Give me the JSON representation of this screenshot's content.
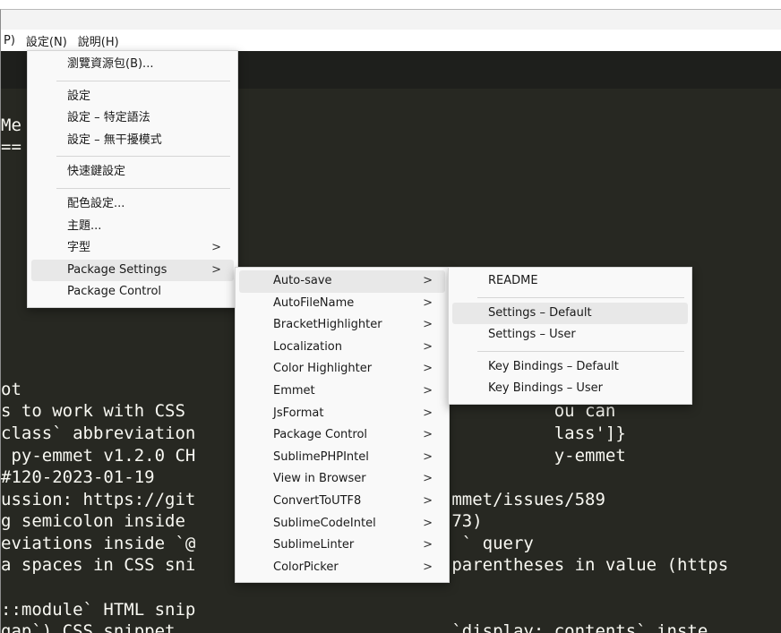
{
  "menubar": {
    "items": [
      "P)",
      "設定(N)",
      "說明(H)"
    ]
  },
  "editor": {
    "lines": [
      "",
      "Me",
      "==",
      "",
      "",
      "",
      "",
      "",
      "",
      "",
      "",
      "",
      "",
      "ot",
      "s to work with CSS                                    ou can",
      "class` abbreviation                                   lass']}",
      " py-emmet v1.2.0 CH                                   y-emmet",
      "#120-2023-01-19",
      "ussion: https://git                         mmet/issues/589",
      "g semicolon inside                          73)",
      "eviations inside `@                          ` query",
      "a spaces in CSS sni                         parentheses in value (https",
      "",
      "::module` HTML snip",
      "gap`) CSS snippet,                          `display: contents` inste"
    ]
  },
  "preferences_menu": {
    "browse_packages": "瀏覽資源包(B)...",
    "settings": "設定",
    "settings_syntax": "設定 – 特定語法",
    "settings_distraction_free": "設定 – 無干擾模式",
    "key_bindings": "快速鍵設定",
    "color_scheme": "配色設定...",
    "theme": "主題...",
    "font": "字型",
    "package_settings": "Package Settings",
    "package_control": "Package Control"
  },
  "package_settings_menu": {
    "items": [
      "Auto-save",
      "AutoFileName",
      "BracketHighlighter",
      "Localization",
      "Color Highlighter",
      "Emmet",
      "JsFormat",
      "Package Control",
      "SublimePHPIntel",
      "View in Browser",
      "ConvertToUTF8",
      "SublimeCodeIntel",
      "SublimeLinter",
      "ColorPicker"
    ],
    "arrow": ">"
  },
  "autosave_menu": {
    "readme": "README",
    "settings_default": "Settings – Default",
    "settings_user": "Settings – User",
    "key_bindings_default": "Key Bindings – Default",
    "key_bindings_user": "Key Bindings – User"
  },
  "colors": {
    "editor_bg": "#272822",
    "editor_fg": "#f8f8f2",
    "menu_bg": "#f9f9f9",
    "menu_highlight": "#e8e8e8"
  }
}
